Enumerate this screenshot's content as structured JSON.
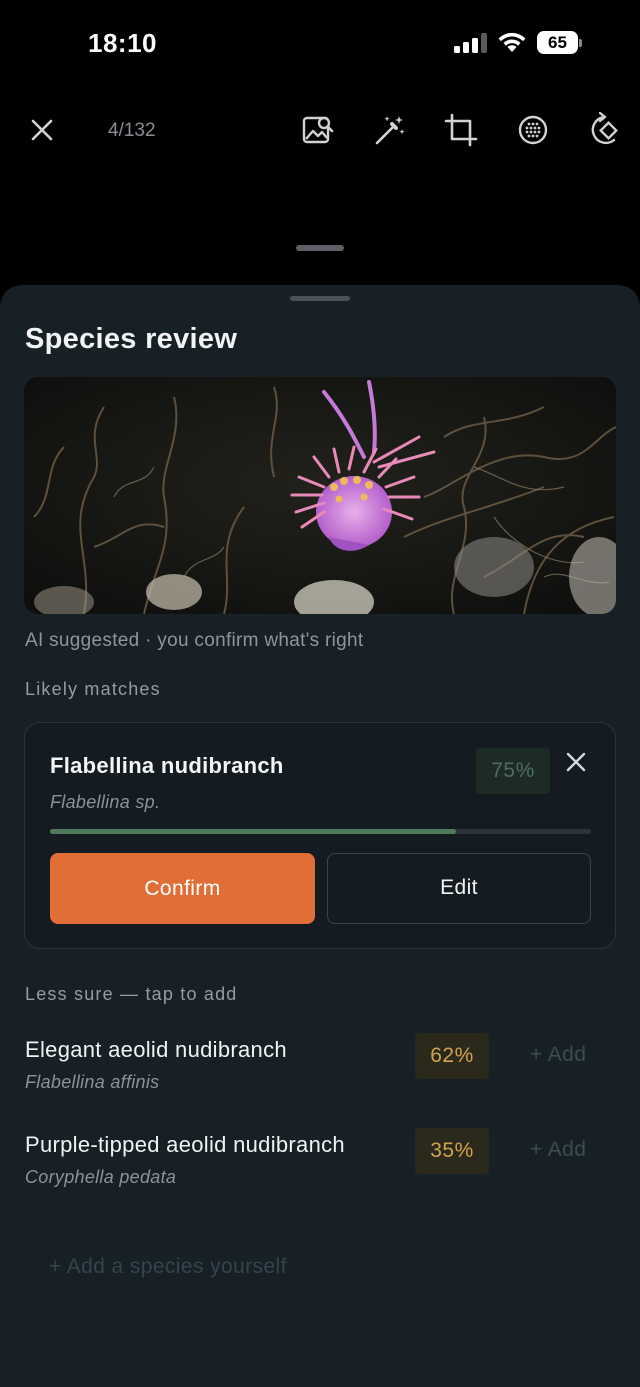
{
  "status_bar": {
    "time": "18:10",
    "battery": "65"
  },
  "toolbar": {
    "counter": "4/132",
    "icons": [
      "close-icon",
      "image-search-icon",
      "magic-wand-icon",
      "crop-icon",
      "grid-circle-icon",
      "rotate-icon"
    ]
  },
  "sheet": {
    "title": "Species review",
    "ai_note": "AI suggested · you confirm what's right",
    "likely_label": "Likely matches",
    "top_match": {
      "name": "Flabellina nudibranch",
      "scientific": "Flabellina sp.",
      "confidence": "75%",
      "confidence_value": 0.75,
      "confirm_label": "Confirm",
      "edit_label": "Edit"
    },
    "less_sure_label": "Less sure — tap to add",
    "alternatives": [
      {
        "name": "Elegant aeolid nudibranch",
        "scientific": "Flabellina affinis",
        "confidence": "62%",
        "add_label": "+ Add"
      },
      {
        "name": "Purple-tipped aeolid nudibranch",
        "scientific": "Coryphella pedata",
        "confidence": "35%",
        "add_label": "+ Add"
      }
    ],
    "add_own_label": "+ Add a species yourself"
  },
  "colors": {
    "background": "#000000",
    "sheet": "#172025",
    "accent": "#e06e36",
    "high_confidence": "#4f7a5c",
    "medium_confidence": "#d4a24a"
  }
}
